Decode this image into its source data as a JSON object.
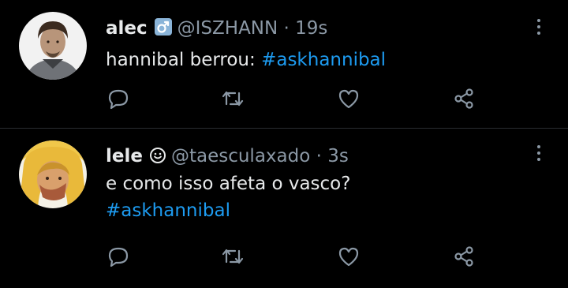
{
  "tweets": [
    {
      "display_name": "alec",
      "badge_icon": "male-symbol-emoji-icon",
      "handle": "@ISZHANN",
      "separator": "·",
      "time": "19s",
      "text_before": "hannibal berrou: ",
      "hashtag": "#askhannibal",
      "text_after": ""
    },
    {
      "display_name": "lele",
      "badge_icon": "smiley-icon",
      "handle": "@taesculaxado",
      "separator": "·",
      "time": "3s",
      "text_before": "e como isso afeta o vasco?",
      "hashtag": "#askhannibal",
      "text_after": ""
    }
  ],
  "colors": {
    "background": "#000000",
    "text": "#e7e9ea",
    "muted": "#8b98a5",
    "accent": "#1d9bf0",
    "divider": "#2a2d31"
  },
  "icons": [
    "reply-icon",
    "retweet-icon",
    "like-icon",
    "share-icon",
    "more-options-icon"
  ]
}
